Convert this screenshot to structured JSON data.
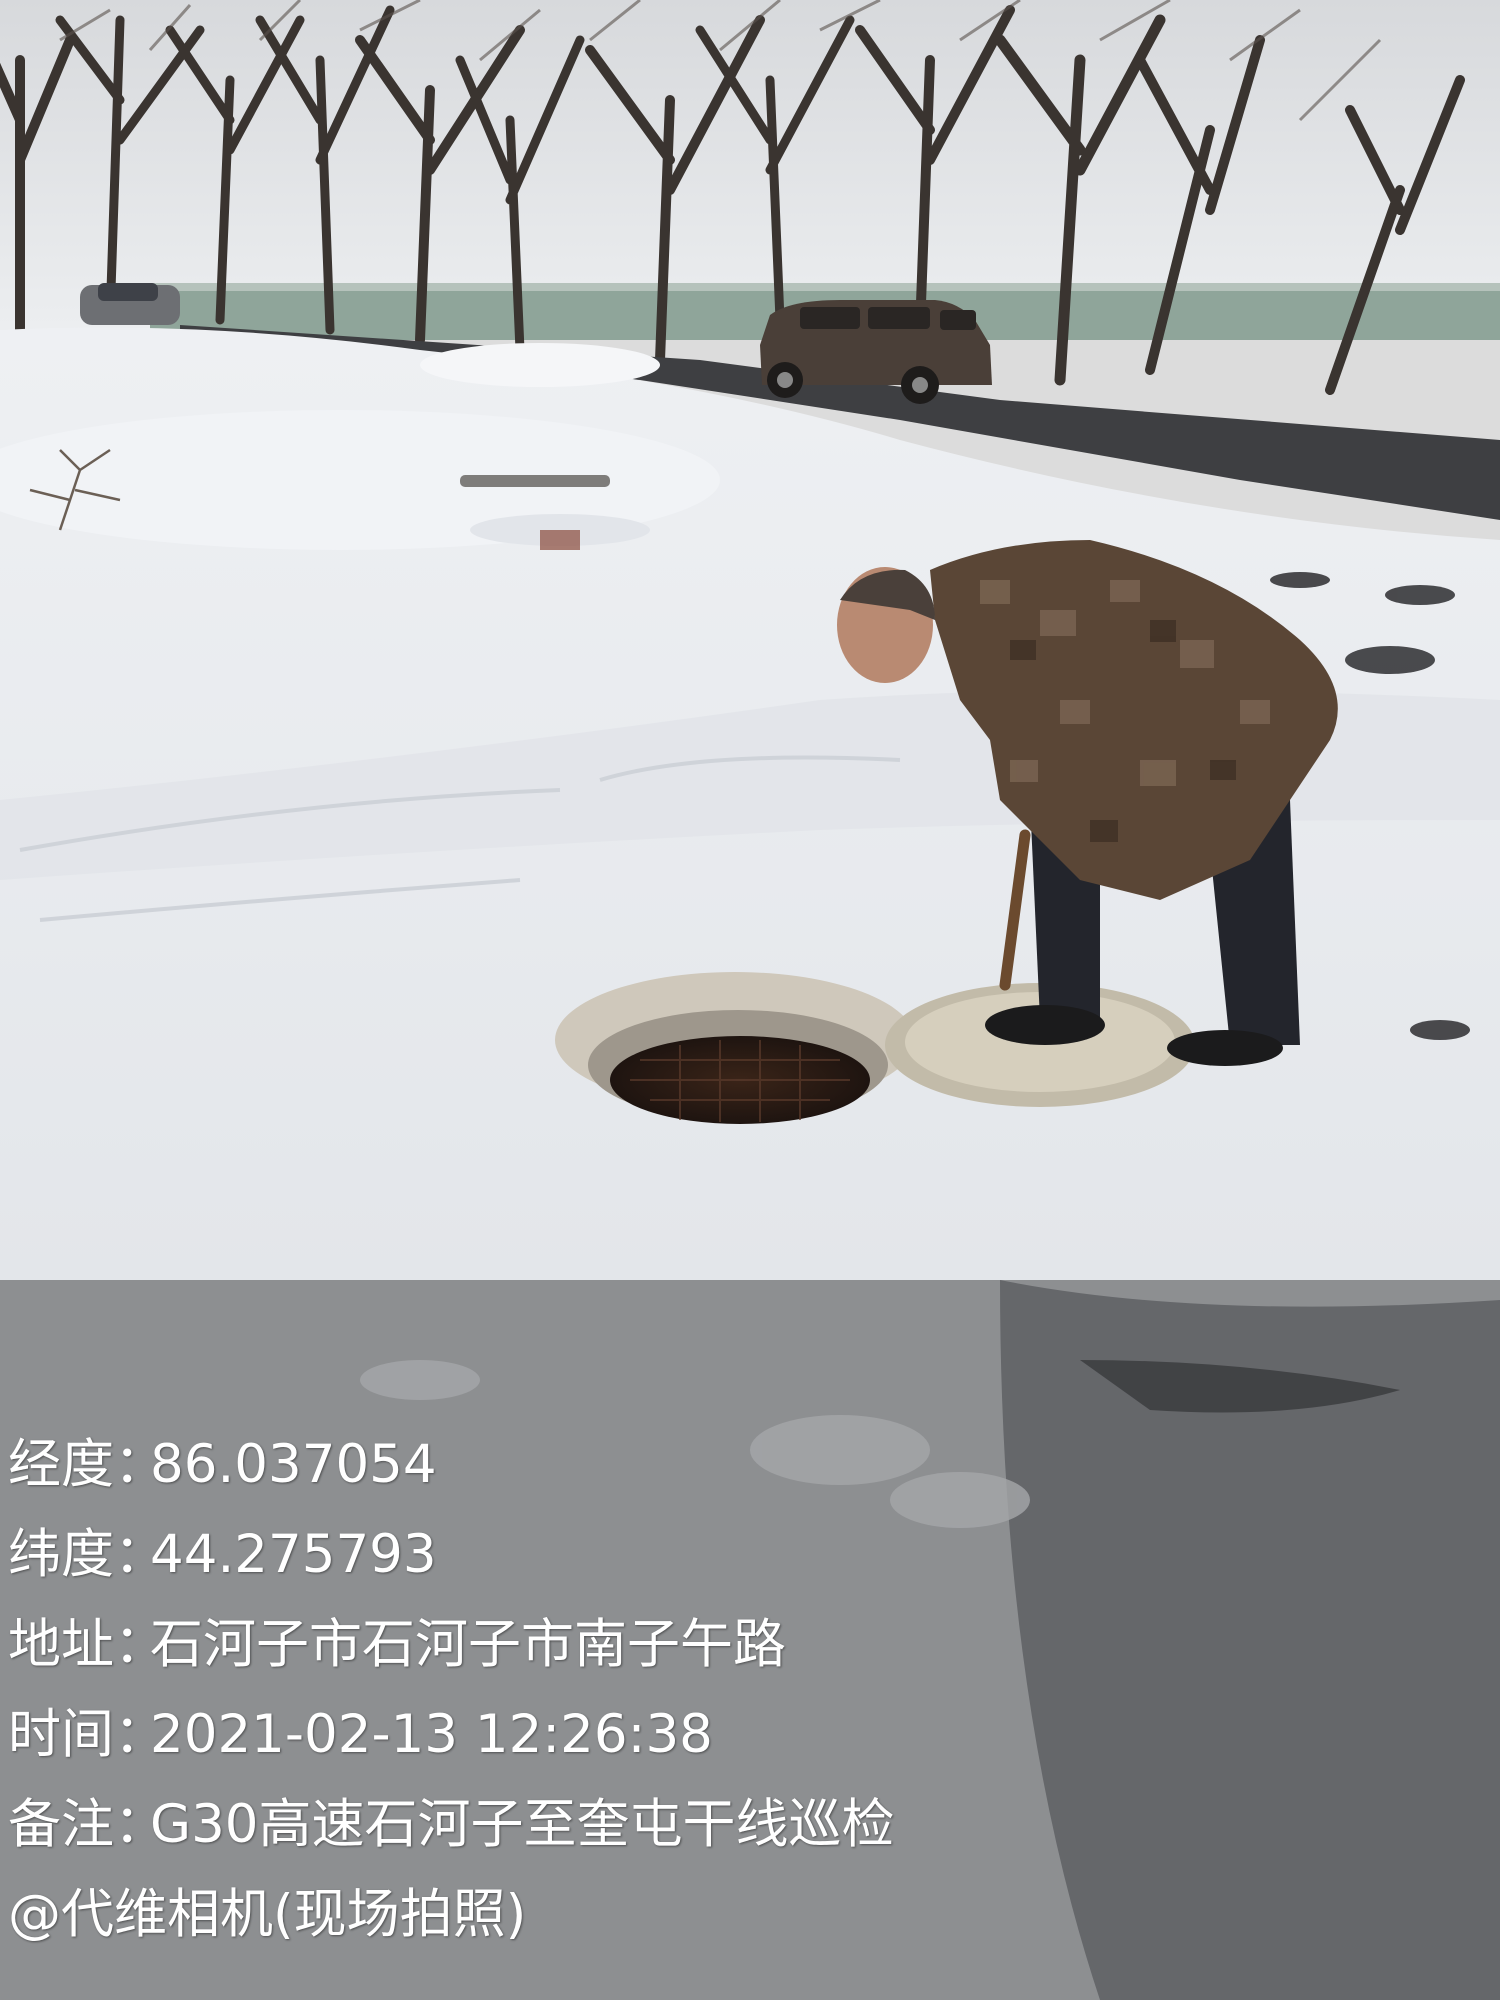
{
  "colors": {
    "sky": "#e6e8ea",
    "snow": "#f3f4f6",
    "asphalt": "#3b3b3d",
    "coat": "#5a4636",
    "overlay_text": "#ffffff"
  },
  "watermark": {
    "longitude_label": "经度",
    "longitude_value": "86.037054",
    "latitude_label": "纬度",
    "latitude_value": "44.275793",
    "address_label": "地址",
    "address_value": "石河子市石河子市南子午路",
    "time_label": "时间",
    "time_value": "2021-02-13 12:26:38",
    "note_label": "备注",
    "note_value": "G30高速石河子至奎屯干线巡检",
    "separator": "：",
    "camera_credit": "@代维相机(现场拍照)"
  }
}
